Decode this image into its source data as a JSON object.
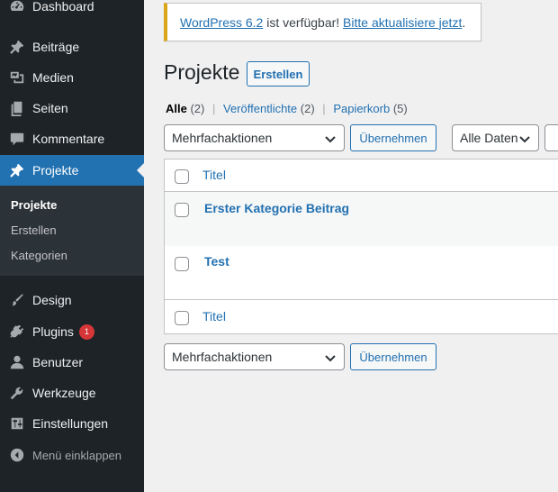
{
  "sidebar": {
    "items": [
      {
        "label": "Dashboard",
        "icon": "dashboard-icon"
      },
      {
        "label": "Beiträge",
        "icon": "pushpin-icon"
      },
      {
        "label": "Medien",
        "icon": "media-icon"
      },
      {
        "label": "Seiten",
        "icon": "pages-icon"
      },
      {
        "label": "Kommentare",
        "icon": "comment-icon"
      },
      {
        "label": "Projekte",
        "icon": "pushpin-icon"
      },
      {
        "label": "Design",
        "icon": "brush-icon"
      },
      {
        "label": "Plugins",
        "icon": "plugin-icon",
        "badge": "1"
      },
      {
        "label": "Benutzer",
        "icon": "user-icon"
      },
      {
        "label": "Werkzeuge",
        "icon": "wrench-icon"
      },
      {
        "label": "Einstellungen",
        "icon": "settings-icon"
      }
    ],
    "submenu": [
      "Projekte",
      "Erstellen",
      "Kategorien"
    ],
    "collapse_label": "Menü einklappen"
  },
  "notice": {
    "link1": "WordPress 6.2",
    "text": " ist verfügbar! ",
    "link2": "Bitte aktualisiere jetzt",
    "suffix": "."
  },
  "page": {
    "title": "Projekte",
    "add_new": "Erstellen"
  },
  "views": [
    {
      "label": "Alle",
      "count": "(2)"
    },
    {
      "label": "Veröffentlichte",
      "count": "(2)"
    },
    {
      "label": "Papierkorb",
      "count": "(5)"
    }
  ],
  "bulk": {
    "select_value": "Mehrfachaktionen",
    "apply": "Übernehmen",
    "date_value": "Alle Daten"
  },
  "table": {
    "header": "Titel",
    "rows": [
      "Erster Kategorie Beitrag",
      "Test"
    ],
    "footer": "Titel"
  },
  "colors": {
    "sidebar_bg": "#1d2327",
    "accent": "#2271b1",
    "notice_border": "#dba617",
    "badge": "#d63638"
  }
}
